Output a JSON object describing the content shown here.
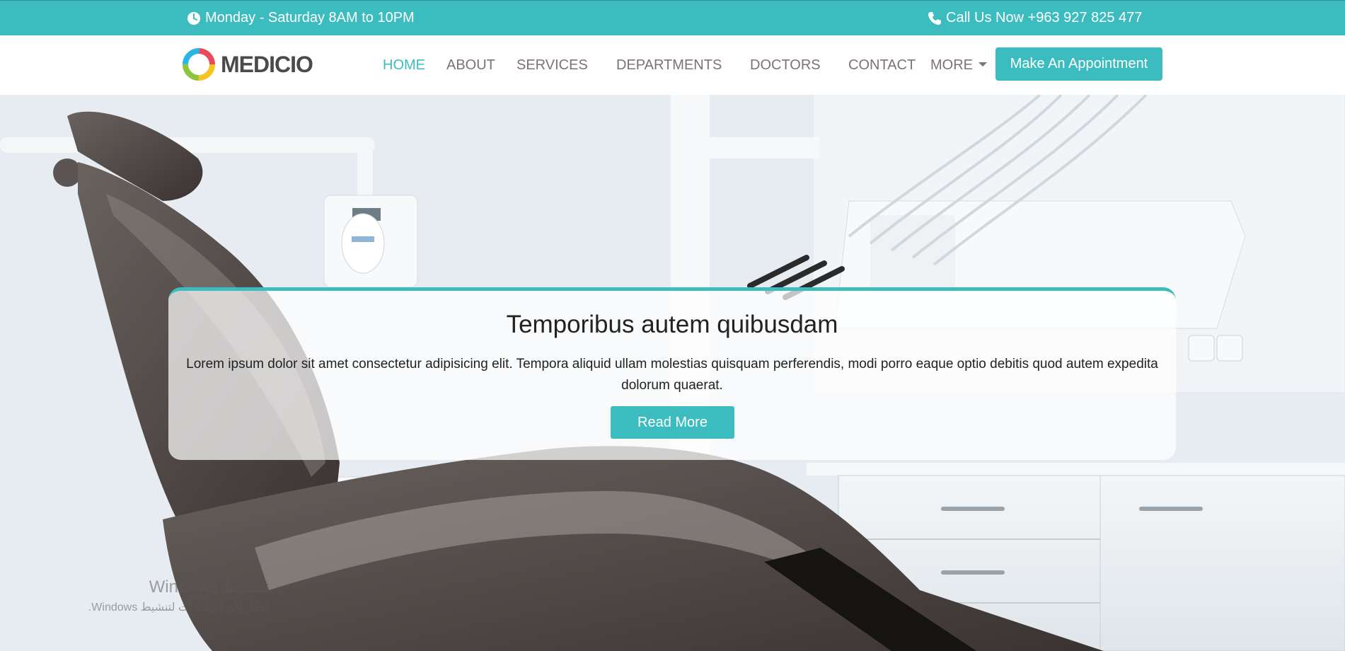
{
  "topbar": {
    "hours": "Monday - Saturday 8AM to 10PM",
    "phone": "Call Us Now +963 927 825 477",
    "background": "#3dbcbf"
  },
  "header": {
    "logo_text": "MEDICIO",
    "nav": [
      {
        "label": "HOME",
        "active": true
      },
      {
        "label": "ABOUT",
        "active": false
      },
      {
        "label": "SERVICES",
        "active": false
      },
      {
        "label": "DEPARTMENTS",
        "active": false
      },
      {
        "label": "DOCTORS",
        "active": false
      },
      {
        "label": "CONTACT",
        "active": false
      },
      {
        "label": "MORE",
        "active": false
      }
    ],
    "cta_label": "Make An Appointment"
  },
  "hero": {
    "title": "Temporibus autem quibusdam",
    "text": "Lorem ipsum dolor sit amet consectetur adipisicing elit. Tempora aliquid ullam molestias quisquam perferendis, modi porro eaque optio debitis quod autem expedita dolorum quaerat.",
    "button_label": "Read More"
  },
  "watermark": {
    "line1": "تنشيط Windows",
    "line2": "انتقل إلى الإعدادات لتنشيط Windows."
  },
  "colors": {
    "accent": "#3dbcbf",
    "nav_text": "#7d7373"
  },
  "icons": {
    "hours": "clock-icon",
    "phone": "phone-icon",
    "more": "caret-down-icon"
  }
}
